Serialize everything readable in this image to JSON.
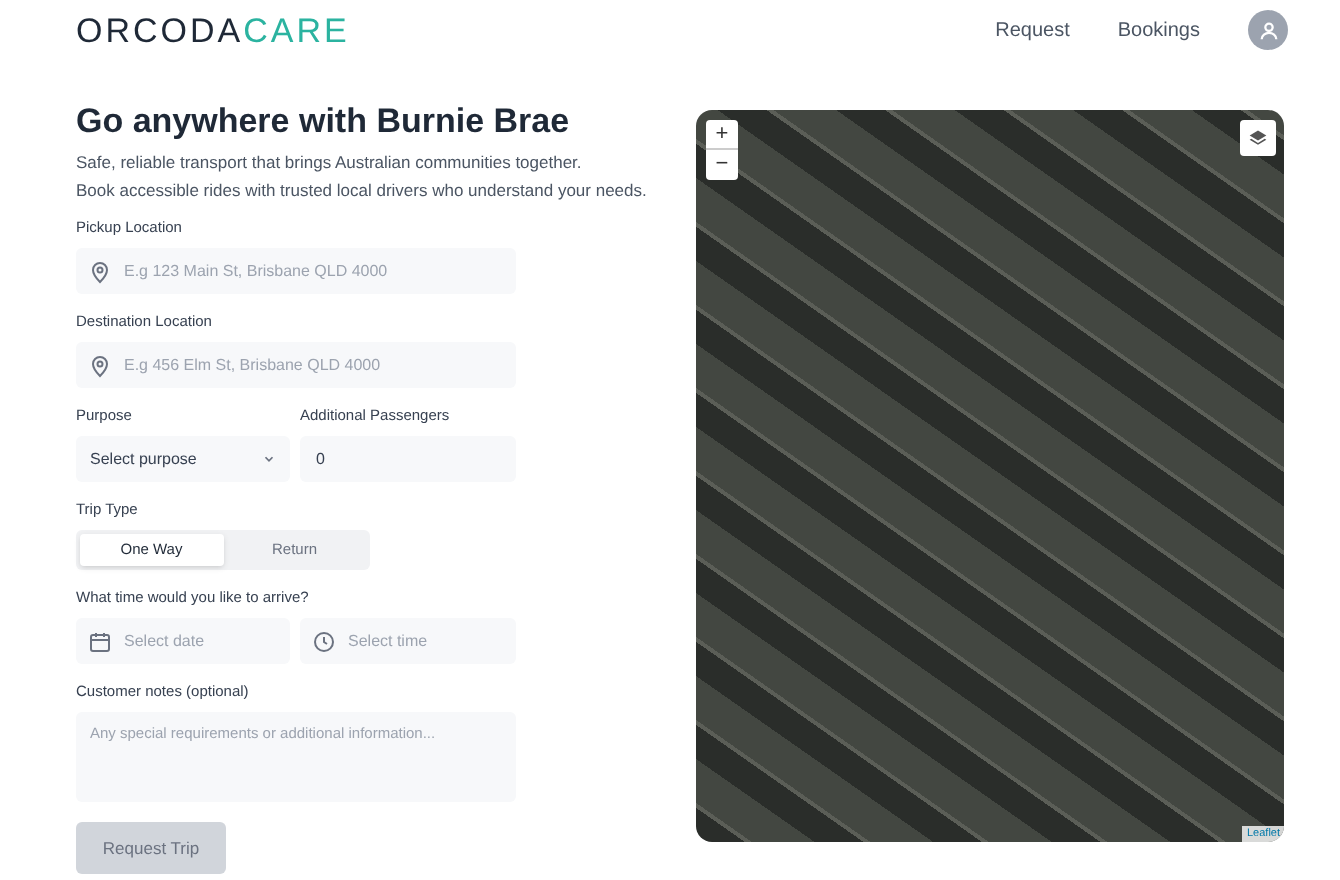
{
  "header": {
    "logo": [
      "ORCODA",
      "CARE"
    ],
    "nav": [
      "Request",
      "Bookings"
    ]
  },
  "hero": {
    "title": "Go anywhere with Burnie Brae",
    "subtitle": [
      "Safe, reliable transport that brings Australian communities together.",
      "Book accessible rides with trusted local drivers who understand your needs."
    ]
  },
  "form": {
    "pickup": {
      "label": "Pickup Location",
      "placeholder": "E.g 123 Main St, Brisbane QLD 4000"
    },
    "destination": {
      "label": "Destination Location",
      "placeholder": "E.g 456 Elm St, Brisbane QLD 4000"
    },
    "purpose": {
      "label": "Purpose",
      "value": "Select purpose"
    },
    "passengers": {
      "label": "Additional Passengers",
      "value": "0"
    },
    "trip_type": {
      "label": "Trip Type",
      "options": [
        {
          "label": "One Way",
          "selected": true
        },
        {
          "label": "Return",
          "selected": false
        }
      ]
    },
    "arrival": {
      "label": "What time would you like to arrive?",
      "date_placeholder": "Select date",
      "time_placeholder": "Select time"
    },
    "notes": {
      "label": "Customer notes (optional)",
      "placeholder": "Any special requirements or additional information..."
    },
    "submit": {
      "label": "Request Trip",
      "disabled": true
    }
  },
  "map": {
    "zoom_in": "+",
    "zoom_out": "−",
    "attribution": "Leaflet"
  }
}
